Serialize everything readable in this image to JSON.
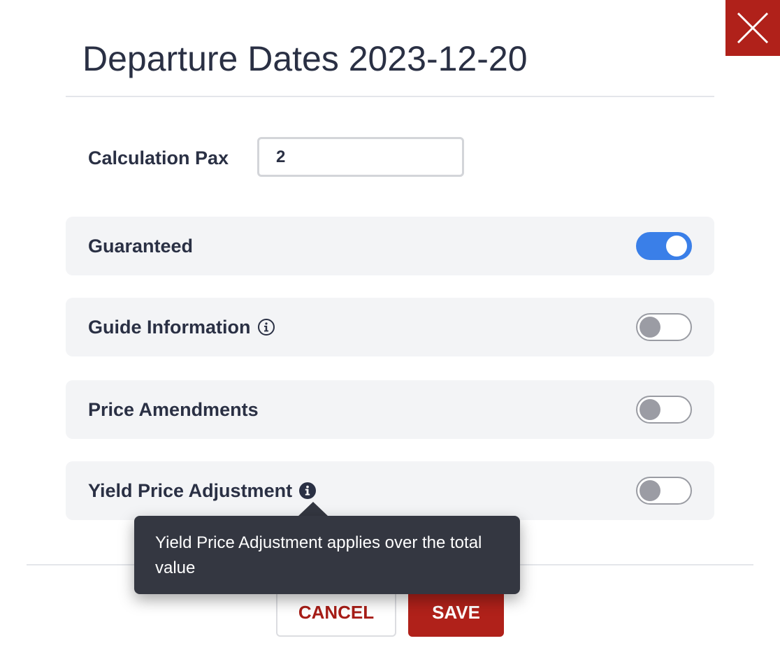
{
  "dialog": {
    "title": "Departure Dates 2023-12-20",
    "close_icon": "close-x-icon"
  },
  "form": {
    "calculation_pax": {
      "label": "Calculation Pax",
      "value": "2"
    },
    "toggles": [
      {
        "label": "Guaranteed",
        "checked": true,
        "has_info": false
      },
      {
        "label": "Guide Information",
        "checked": false,
        "has_info": true,
        "info_icon": "info-outline-icon"
      },
      {
        "label": "Price Amendments",
        "checked": false,
        "has_info": false
      },
      {
        "label": "Yield Price Adjustment",
        "checked": false,
        "has_info": true,
        "info_icon": "info-filled-icon"
      }
    ]
  },
  "tooltip": {
    "text": "Yield Price Adjustment applies over the total value"
  },
  "footer": {
    "cancel_label": "CANCEL",
    "save_label": "SAVE"
  },
  "colors": {
    "accent_red": "#b0211a",
    "toggle_on": "#3a7fe8",
    "text": "#2a3044",
    "row_background": "#f3f4f6",
    "tooltip_background": "#343741"
  }
}
